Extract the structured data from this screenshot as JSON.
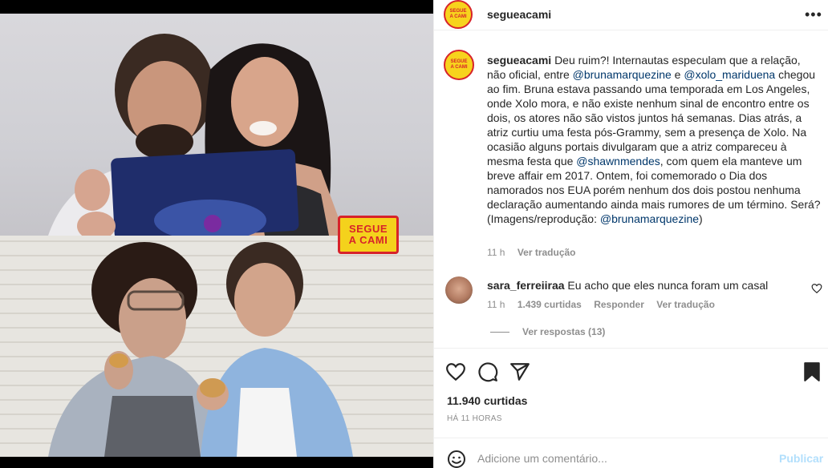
{
  "brand": {
    "logo_line1": "SEGUE",
    "logo_line2": "A CAMI",
    "color_yellow": "#f4d21c",
    "color_red": "#d7232a"
  },
  "post": {
    "username": "segueacami",
    "more_icon": "more-horizontal-icon",
    "more_label": "•••"
  },
  "caption": {
    "username": "segueacami",
    "segments": [
      {
        "t": "Deu ruim?! Internautas especulam que a relação, não oficial, entre "
      },
      {
        "t": "@brunamarquezine",
        "mention": true
      },
      {
        "t": " e "
      },
      {
        "t": "@xolo_mariduena",
        "mention": true
      },
      {
        "t": " chegou ao fim. Bruna estava passando uma temporada em Los Angeles, onde Xolo mora, e não existe nenhum sinal de encontro entre os dois, os atores não são vistos juntos há semanas. Dias atrás, a atriz curtiu uma festa pós-Grammy, sem a presença de Xolo. Na ocasião alguns portais divulgaram que a atriz compareceu à mesma festa que "
      },
      {
        "t": "@shawnmendes",
        "mention": true
      },
      {
        "t": ", com quem ela manteve um breve affair em 2017. Ontem, foi comemorado o Dia dos namorados nos EUA porém nenhum dos dois postou nenhuma declaração aumentando ainda mais rumores de um término. Será?"
      },
      {
        "t": "\n(Imagens/reprodução: "
      },
      {
        "t": "@brunamarquezine",
        "mention": true
      },
      {
        "t": ")"
      }
    ],
    "time": "11 h",
    "translate": "Ver tradução"
  },
  "comment": {
    "username": "sara_ferreiiraa",
    "text": "Eu acho que eles nunca foram um casal",
    "time": "11 h",
    "likes": "1.439 curtidas",
    "reply": "Responder",
    "translate": "Ver tradução",
    "view_replies": "Ver respostas (13)"
  },
  "actions": {
    "likes": "11.940 curtidas",
    "date": "HÁ 11 HORAS"
  },
  "comment_bar": {
    "placeholder": "Adicione um comentário...",
    "publish": "Publicar",
    "publish_color": "#b2dffc"
  }
}
